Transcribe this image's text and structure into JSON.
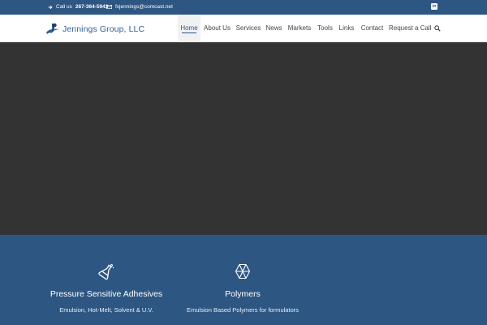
{
  "topbar": {
    "call_label": "Call us",
    "phone": "267-364-5943",
    "email": "fxjennings@comcast.net",
    "social_icon": "linkedin-icon"
  },
  "header": {
    "logo_text": "Jennings Group, LLC",
    "nav": [
      {
        "label": "Home",
        "active": true
      },
      {
        "label": "About Us"
      },
      {
        "label": "Services"
      },
      {
        "label": "News"
      },
      {
        "label": "Markets"
      },
      {
        "label": "Tools"
      },
      {
        "label": "Links"
      },
      {
        "label": "Contact"
      },
      {
        "label": "Request a Call"
      }
    ],
    "search_icon": "search-icon"
  },
  "services": [
    {
      "icon": "flask-icon",
      "title": "Pressure Sensitive Adhesives",
      "desc": "Emulsion, Hot-Melt, Solvent & U.V."
    },
    {
      "icon": "polymer-icon",
      "title": "Polymers",
      "desc": "Emulsion Based Polymers for formulators"
    }
  ],
  "colors": {
    "brand_blue": "#2e5683",
    "hero_dark": "#333334",
    "logo_blue": "#2e5f9c"
  }
}
